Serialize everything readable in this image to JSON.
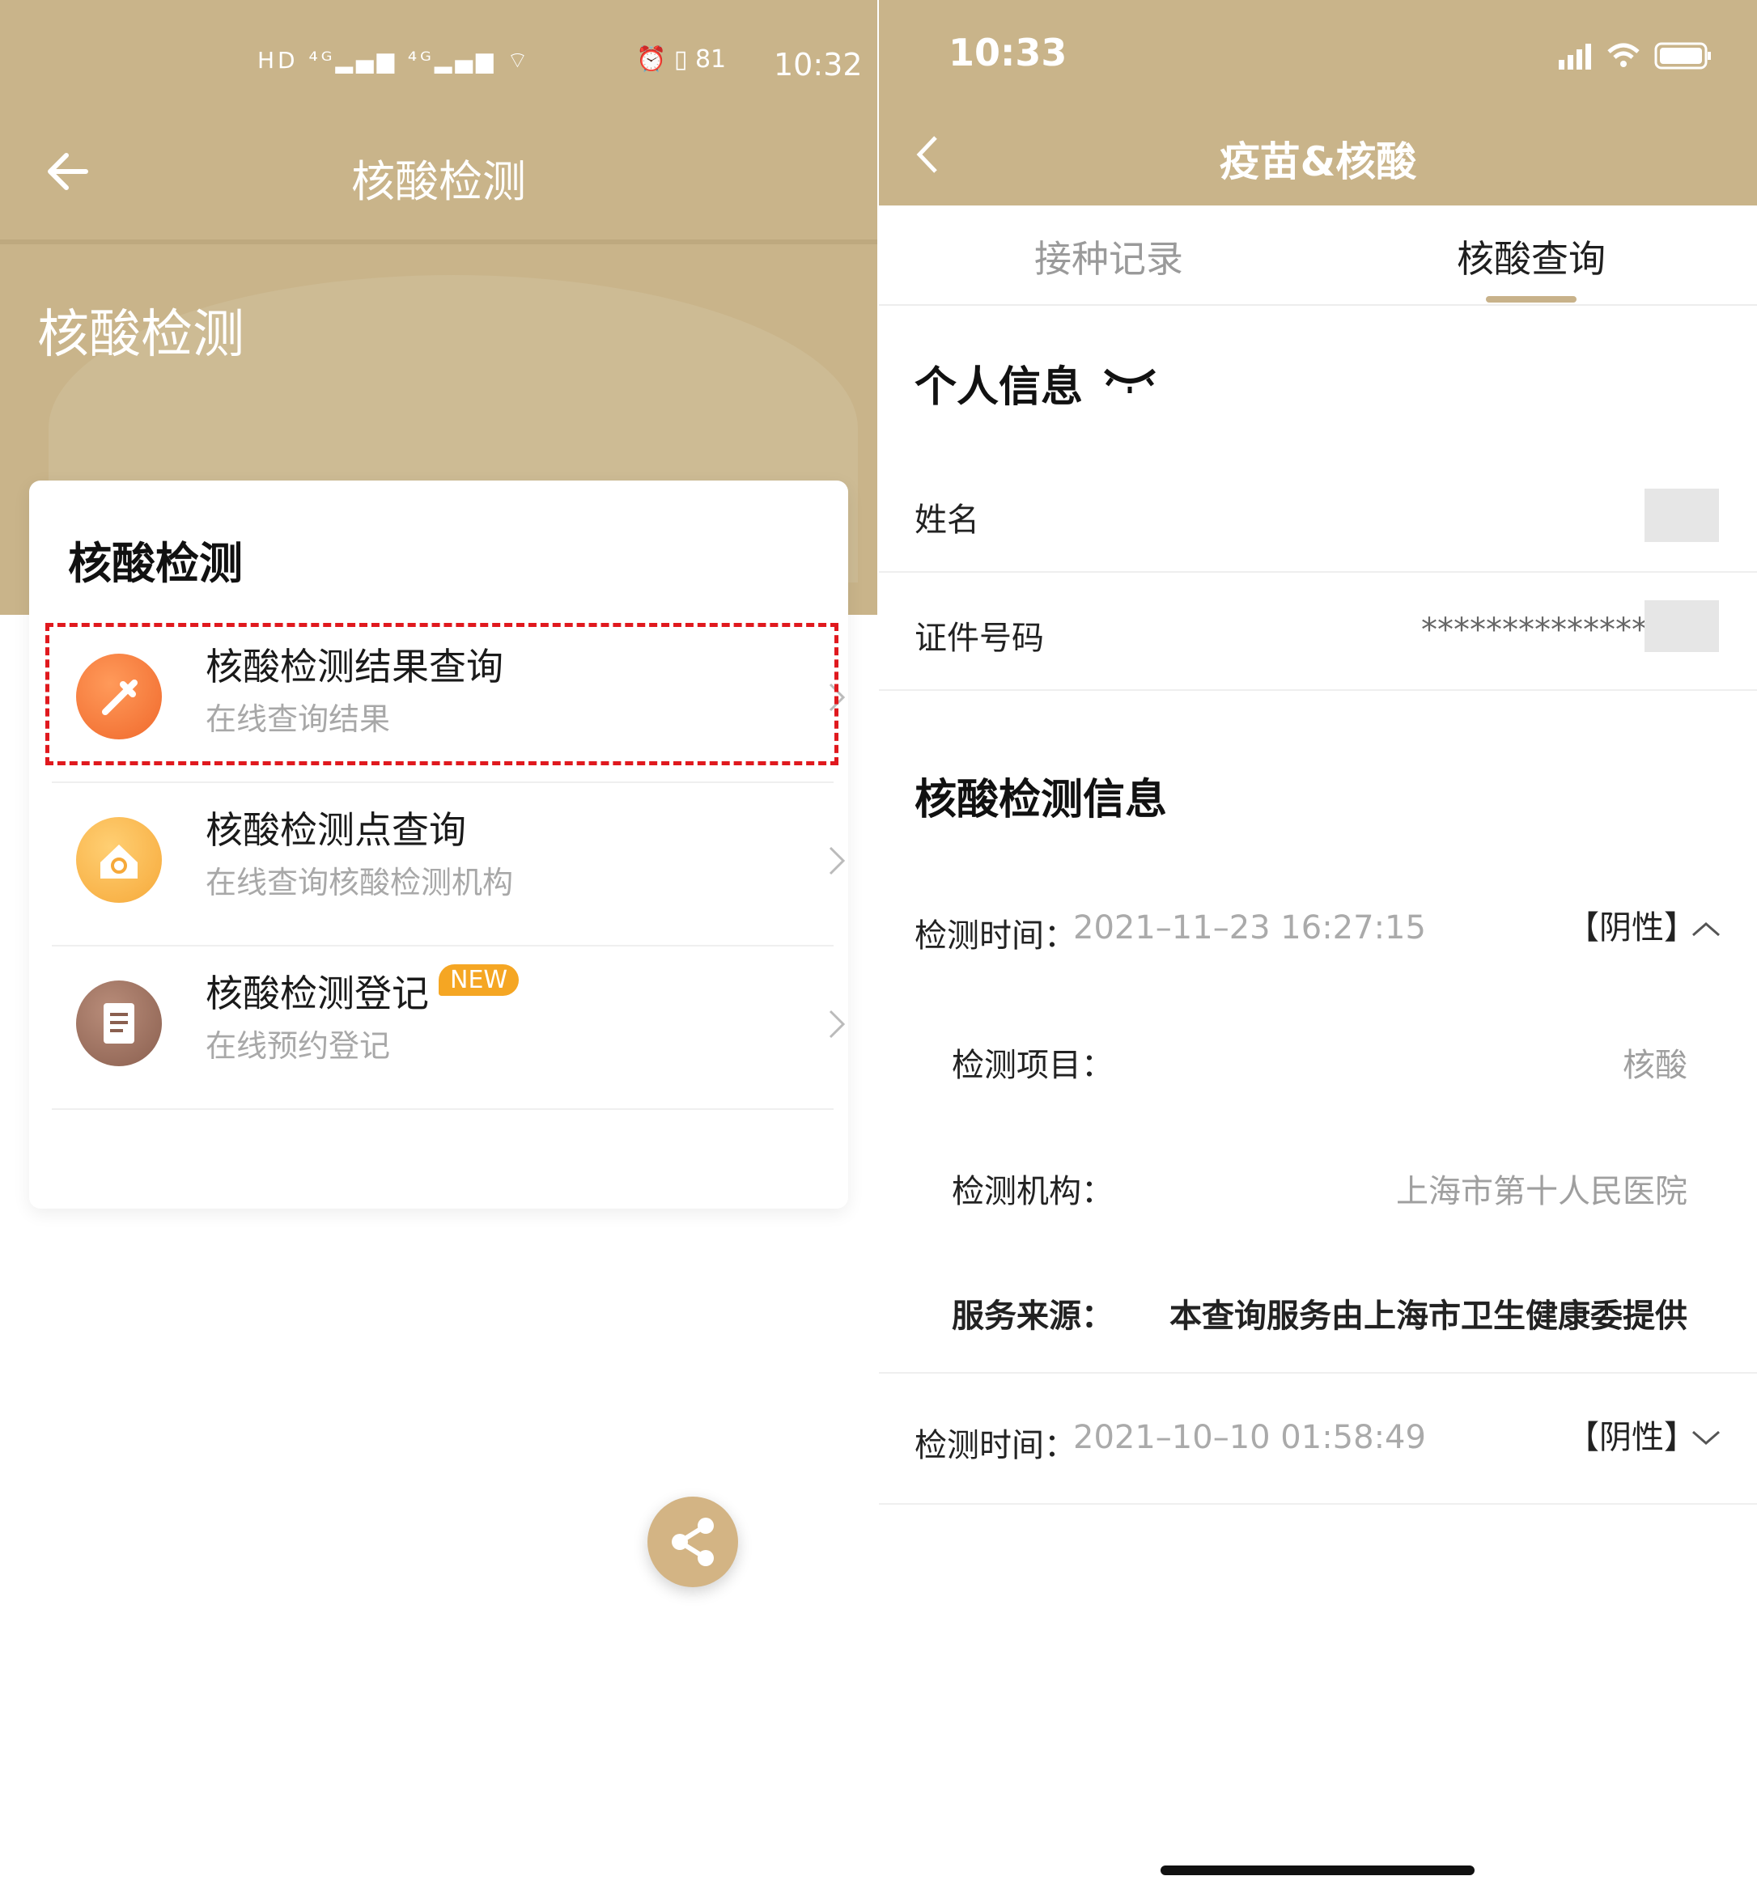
{
  "left": {
    "status": {
      "time": "10:32",
      "battery": "81"
    },
    "nav": {
      "title": "核酸检测"
    },
    "banner": {
      "title": "核酸检测"
    },
    "card": {
      "title": "核酸检测",
      "items": [
        {
          "title": "核酸检测结果查询",
          "subtitle": "在线查询结果",
          "icon": "pipette-icon"
        },
        {
          "title": "核酸检测点查询",
          "subtitle": "在线查询核酸检测机构",
          "icon": "home-search-icon"
        },
        {
          "title": "核酸检测登记",
          "subtitle": "在线预约登记",
          "badge": "NEW",
          "icon": "document-icon"
        }
      ]
    },
    "colors": {
      "header": "#c9b48a",
      "highlight": "#e0191e",
      "badge": "#f5a623",
      "share": "#d3b484"
    }
  },
  "right": {
    "status": {
      "time": "10:33"
    },
    "nav": {
      "title": "疫苗&核酸"
    },
    "tabs": [
      {
        "label": "接种记录",
        "active": false
      },
      {
        "label": "核酸查询",
        "active": true
      }
    ],
    "personal": {
      "title": "个人信息",
      "name_label": "姓名",
      "id_label": "证件号码",
      "id_value": "**************"
    },
    "test_info": {
      "title": "核酸检测信息",
      "records": [
        {
          "time_label": "检测时间：",
          "time": "2021–11–23 16:27:15",
          "result": "【阴性】",
          "expanded": true,
          "details": [
            {
              "label": "检测项目：",
              "value": "核酸"
            },
            {
              "label": "检测机构：",
              "value": "上海市第十人民医院"
            },
            {
              "label": "服务来源：",
              "value": "本查询服务由上海市卫生健康委提供"
            }
          ]
        },
        {
          "time_label": "检测时间：",
          "time": "2021–10–10 01:58:49",
          "result": "【阴性】",
          "expanded": false
        }
      ]
    }
  }
}
